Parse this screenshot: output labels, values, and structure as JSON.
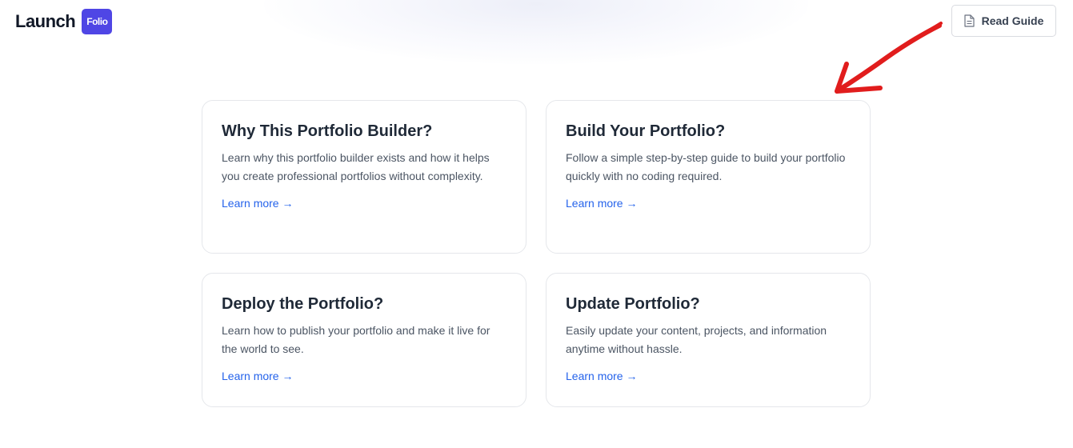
{
  "header": {
    "logo_text": "Launch",
    "logo_badge": "Folio",
    "read_guide_label": "Read Guide"
  },
  "cards": [
    {
      "title": "Why This Portfolio Builder?",
      "description": "Learn why this portfolio builder exists and how it helps you create professional portfolios without complexity.",
      "link": "Learn more →"
    },
    {
      "title": "Build Your Portfolio?",
      "description": "Follow a simple step-by-step guide to build your portfolio quickly with no coding required.",
      "link": "Learn more →"
    },
    {
      "title": "Deploy the Portfolio?",
      "description": "Learn how to publish your portfolio and make it live for the world to see.",
      "link": "Learn more →"
    },
    {
      "title": "Update Portfolio?",
      "description": "Easily update your content, projects, and information anytime without hassle.",
      "link": "Learn more →"
    }
  ],
  "colors": {
    "brand": "#4f46e5",
    "link": "#2563eb",
    "annotation": "#e11d1d"
  }
}
